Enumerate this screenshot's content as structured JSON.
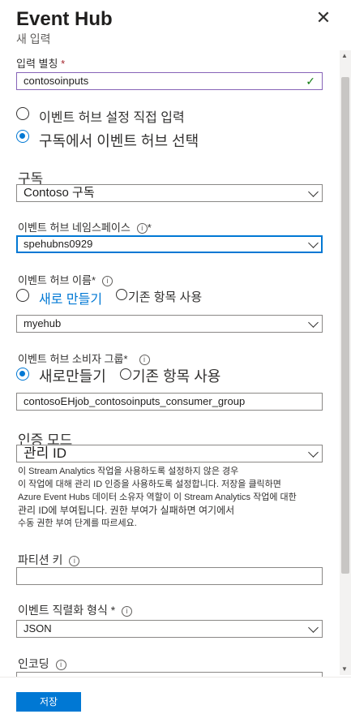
{
  "panel": {
    "title": "Event Hub",
    "subtitle": "새 입력",
    "close_icon": "close-icon"
  },
  "input_alias": {
    "label": "입력 별칭",
    "required_mark": "*",
    "value": "contosoinputs"
  },
  "source_options": {
    "manual": "이벤트 허브 설정 직접 입력",
    "from_subscription": "구독에서 이벤트 허브 선택",
    "selected": "from_subscription"
  },
  "subscription": {
    "label": "구독",
    "value": "Contoso 구독"
  },
  "namespace": {
    "label": "이벤트 허브 네임스페이스",
    "required_mark": "*",
    "value": "spehubns0929"
  },
  "hub_name": {
    "label": "이벤트 허브 이름",
    "required_mark": "*",
    "radio_new": "새로 만들기",
    "radio_existing": "기존 항목 사용",
    "value": "myehub"
  },
  "consumer_group": {
    "label": "이벤트 허브 소비자 그룹",
    "required_mark": "*",
    "radio_new": "새로만들기",
    "radio_existing": "기존 항목 사용",
    "value": "contosoEHjob_contosoinputs_consumer_group"
  },
  "auth_mode": {
    "label": "인증 모드",
    "value": "관리 ID",
    "note_lines": [
      "이 Stream Analytics 작업을 사용하도록 설정하지 않은 경우",
      "이 작업에 대해 관리 ID 인증을 사용하도록 설정합니다. 저장을 클릭하면",
      "Azure Event Hubs 데이터 소유자 역할이 이 Stream Analytics 작업에 대한",
      "관리 ID에 부여됩니다. 권한 부여가 실패하면 여기에서",
      "수동 권한 부여 단계를 따르세요."
    ]
  },
  "partition_key": {
    "label": "파티션 키",
    "value": ""
  },
  "serialization": {
    "label": "이벤트 직렬화 형식",
    "required_mark": "*",
    "value": "JSON"
  },
  "encoding": {
    "label": "인코딩"
  },
  "footer": {
    "save_label": "저장"
  },
  "colors": {
    "accent": "#0078d4",
    "valid": "#107c10",
    "required": "#a4262c"
  }
}
